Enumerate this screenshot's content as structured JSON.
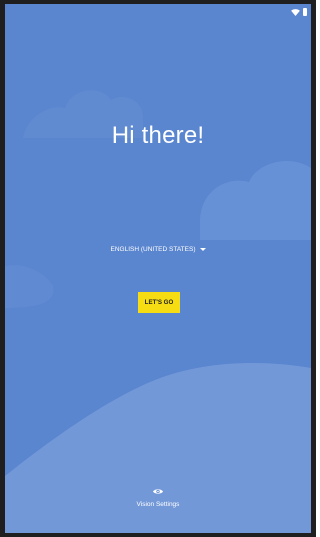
{
  "status_bar": {
    "wifi_icon": "wifi-icon",
    "battery_icon": "battery-icon"
  },
  "welcome": {
    "greeting": "Hi there!",
    "language": "ENGLISH (UNITED STATES)",
    "start_label": "LET'S GO",
    "vision_settings_label": "Vision Settings",
    "vision_icon": "eye-icon"
  },
  "colors": {
    "background": "#5a85cf",
    "cloud_light": "#6b93d6",
    "cloud_bottom": "#7298d8",
    "accent_button": "#f6dd13",
    "button_text": "#1c1c1c",
    "text": "#ffffff",
    "device_frame": "#1f1f1f"
  }
}
